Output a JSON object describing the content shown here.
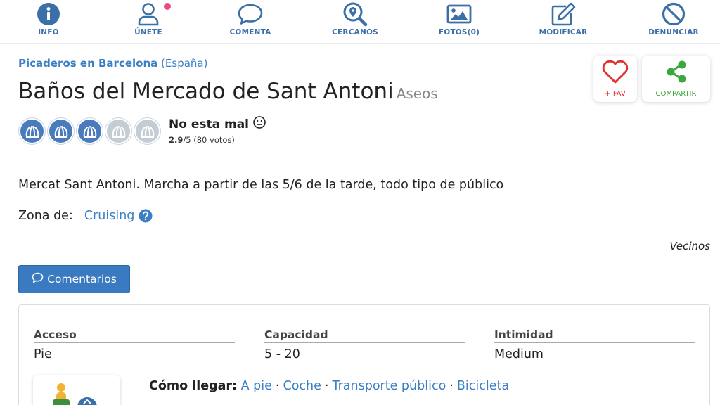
{
  "nav": {
    "items": [
      {
        "label": "INFO",
        "icon": "info-icon"
      },
      {
        "label": "ÚNETE",
        "icon": "user-icon"
      },
      {
        "label": "COMENTA",
        "icon": "speech-bubble-icon"
      },
      {
        "label": "CERCANOS",
        "icon": "search-location-icon"
      },
      {
        "label": "FOTOS(0)",
        "icon": "image-icon"
      },
      {
        "label": "MODIFICAR",
        "icon": "edit-icon"
      },
      {
        "label": "DENUNCIAR",
        "icon": "ban-icon"
      }
    ]
  },
  "breadcrumb": {
    "link": "Picaderos en Barcelona",
    "country": "(España)"
  },
  "place": {
    "title": "Baños del Mercado de Sant Antoni",
    "type": "Aseos"
  },
  "actions": {
    "fav_label": "+ FAV",
    "share_label": "COMPARTIR"
  },
  "rating": {
    "label": "No esta mal",
    "score": "2.9",
    "max": "/5",
    "votes": "(80 votos)",
    "filled": 3,
    "total": 5
  },
  "description": "Mercat Sant Antoni. Marcha a partir de las 5/6 de la tarde, todo tipo de público",
  "zona": {
    "label": "Zona de:",
    "value": "Cruising"
  },
  "vecinos": "Vecinos",
  "comments_button": "Comentarios",
  "info": {
    "acceso": {
      "head": "Acceso",
      "value": "Pie"
    },
    "capacidad": {
      "head": "Capacidad",
      "value": "5 - 20"
    },
    "intimidad": {
      "head": "Intimidad",
      "value": "Medium"
    }
  },
  "como_llegar": {
    "label": "Cómo llegar:",
    "options": [
      "A pie",
      "Coche",
      "Transporte público",
      "Bicicleta"
    ]
  },
  "colors": {
    "accent": "#3b80c4",
    "button": "#3a7ac0",
    "fav": "#e0312f",
    "share": "#3aa83a",
    "notify": "#ef4a7e"
  }
}
